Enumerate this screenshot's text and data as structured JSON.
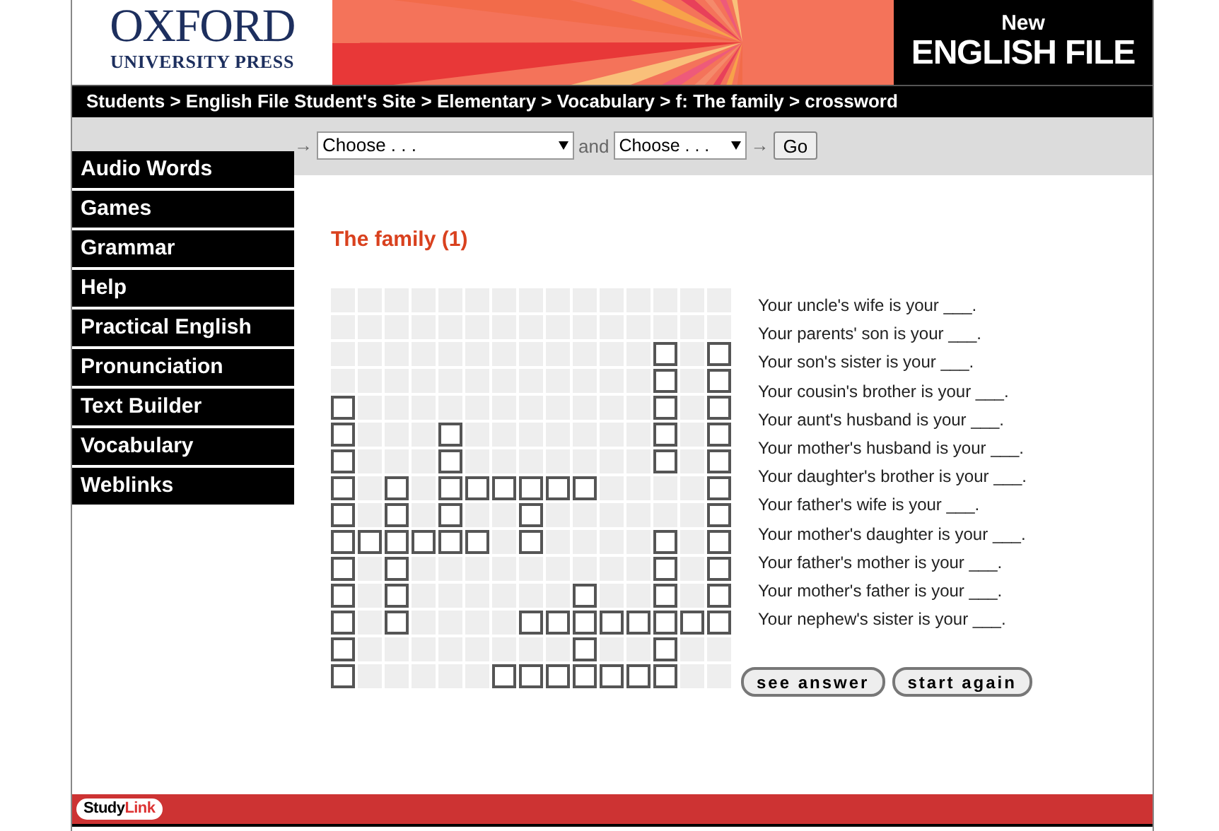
{
  "header": {
    "publisher": "OXFORD",
    "publisher_sub": "UNIVERSITY PRESS",
    "product_small": "New",
    "product": "ENGLISH FILE"
  },
  "breadcrumb": "Students > English File Student's Site > Elementary > Vocabulary > f: The family > crossword",
  "toolbar": {
    "arrow_1": "→",
    "select_1": "Choose . . .",
    "joiner": "and",
    "select_2": "Choose . . .",
    "arrow_2": "→",
    "go": "Go"
  },
  "sidebar": {
    "items": [
      {
        "label": "Audio Words"
      },
      {
        "label": "Games"
      },
      {
        "label": "Grammar"
      },
      {
        "label": "Help"
      },
      {
        "label": "Practical English"
      },
      {
        "label": "Pronunciation"
      },
      {
        "label": "Text Builder"
      },
      {
        "label": "Vocabulary"
      },
      {
        "label": "Weblinks"
      }
    ]
  },
  "title": "The family (1)",
  "grid": [
    [
      false,
      false,
      false,
      false,
      false,
      false,
      false,
      false,
      false,
      false,
      false,
      false,
      false,
      false,
      false
    ],
    [
      false,
      false,
      false,
      false,
      false,
      false,
      false,
      false,
      false,
      false,
      false,
      false,
      false,
      false,
      false
    ],
    [
      false,
      false,
      false,
      false,
      false,
      false,
      false,
      false,
      false,
      false,
      false,
      false,
      true,
      false,
      true
    ],
    [
      false,
      false,
      false,
      false,
      false,
      false,
      false,
      false,
      false,
      false,
      false,
      false,
      true,
      false,
      true
    ],
    [
      true,
      false,
      false,
      false,
      false,
      false,
      false,
      false,
      false,
      false,
      false,
      false,
      true,
      false,
      true
    ],
    [
      true,
      false,
      false,
      false,
      true,
      false,
      false,
      false,
      false,
      false,
      false,
      false,
      true,
      false,
      true
    ],
    [
      true,
      false,
      false,
      false,
      true,
      false,
      false,
      false,
      false,
      false,
      false,
      false,
      true,
      false,
      true
    ],
    [
      true,
      false,
      true,
      false,
      true,
      true,
      true,
      true,
      true,
      true,
      false,
      false,
      false,
      false,
      true
    ],
    [
      true,
      false,
      true,
      false,
      true,
      false,
      false,
      true,
      false,
      false,
      false,
      false,
      false,
      false,
      true
    ],
    [
      true,
      true,
      true,
      true,
      true,
      true,
      false,
      true,
      false,
      false,
      false,
      false,
      true,
      false,
      true
    ],
    [
      true,
      false,
      true,
      false,
      false,
      false,
      false,
      false,
      false,
      false,
      false,
      false,
      true,
      false,
      true
    ],
    [
      true,
      false,
      true,
      false,
      false,
      false,
      false,
      false,
      false,
      true,
      false,
      false,
      true,
      false,
      true
    ],
    [
      true,
      false,
      true,
      false,
      false,
      false,
      false,
      true,
      true,
      true,
      true,
      true,
      true,
      true,
      true
    ],
    [
      true,
      false,
      false,
      false,
      false,
      false,
      false,
      false,
      false,
      true,
      false,
      false,
      true,
      false,
      false
    ],
    [
      true,
      false,
      false,
      false,
      false,
      false,
      true,
      true,
      true,
      true,
      true,
      true,
      true,
      false,
      false
    ]
  ],
  "clues": [
    "Your uncle's wife is your ___.",
    "Your parents' son is your ___.",
    "Your son's sister is your ___.",
    "Your cousin's brother is your ___.",
    "Your aunt's husband is your ___.",
    "Your mother's husband is your ___.",
    "Your daughter's brother is your ___.",
    "Your father's wife is your ___.",
    "Your mother's daughter is your ___.",
    "Your father's mother is your ___.",
    "Your mother's father is your ___.",
    "Your nephew's sister is your ___."
  ],
  "buttons": [
    "see answer",
    "start again"
  ],
  "footer": {
    "logo_1": "Study",
    "logo_2": "Link"
  }
}
